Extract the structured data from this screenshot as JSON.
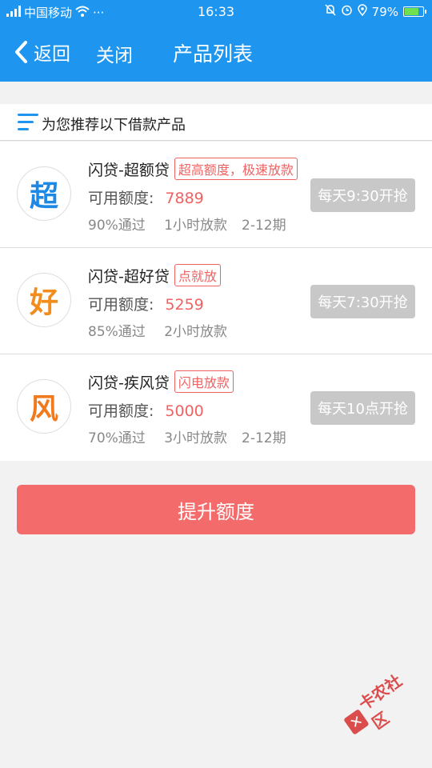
{
  "status_bar": {
    "carrier": "中国移动",
    "dots": "···",
    "time": "16:33",
    "battery": "79%",
    "battery_level": 0.79
  },
  "nav": {
    "back_label": "返回",
    "close_label": "关闭",
    "title": "产品列表"
  },
  "section": {
    "heading": "为您推荐以下借款产品"
  },
  "products": [
    {
      "logo_char": "超",
      "logo_color": "#1e88e5",
      "name": "闪贷-超额贷",
      "tag": "超高额度，极速放款",
      "quota_label": "可用额度:",
      "quota_value": "7889",
      "pass_rate": "90%通过",
      "loan_time": "1小时放款",
      "term": "2-12期",
      "button": "每天9:30开抢"
    },
    {
      "logo_char": "好",
      "logo_color": "#f28c1c",
      "name": "闪贷-超好贷",
      "tag": "点就放",
      "quota_label": "可用额度:",
      "quota_value": "5259",
      "pass_rate": "85%通过",
      "loan_time": "2小时放款",
      "term": "",
      "button": "每天7:30开抢"
    },
    {
      "logo_char": "风",
      "logo_color": "#f07a1c",
      "name": "闪贷-疾风贷",
      "tag": "闪电放款",
      "quota_label": "可用额度:",
      "quota_value": "5000",
      "pass_rate": "70%通过",
      "loan_time": "3小时放款",
      "term": "2-12期",
      "button": "每天10点开抢"
    }
  ],
  "raise_button": "提升额度",
  "watermark": "卡农社区",
  "colors": {
    "brand_blue": "#1e96ef",
    "accent_red": "#f06262",
    "button_red": "#f46b6b",
    "disabled_gray": "#c8c8c8"
  }
}
